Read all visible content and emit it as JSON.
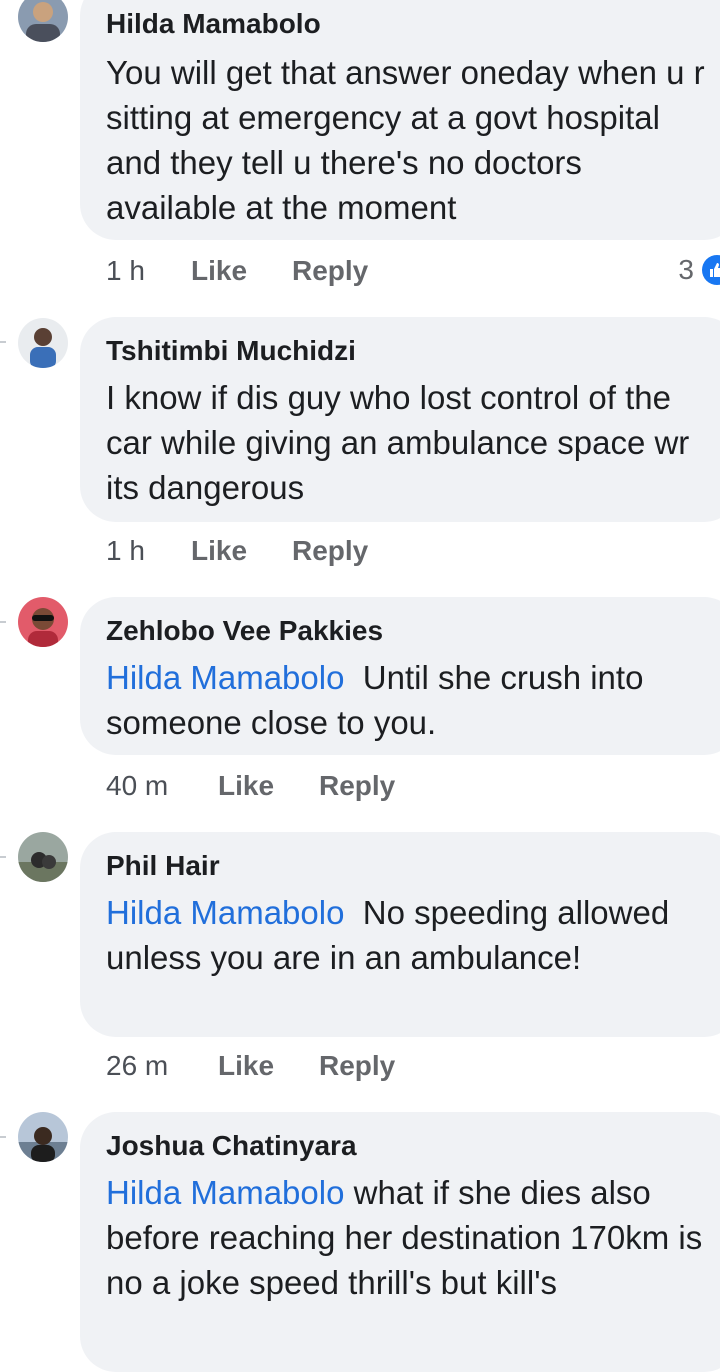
{
  "comments": [
    {
      "author": "Hilda Mamabolo",
      "mention": "",
      "text": "You will get that answer oneday when u r sitting at emergency at a govt hospital and they tell u there's no doctors available at the moment",
      "time": "1 h",
      "like": "Like",
      "reply": "Reply",
      "reactions": "3"
    },
    {
      "author": "Tshitimbi Muchidzi",
      "mention": "",
      "text": "I know if dis guy who lost control of the car while giving an ambulance space wr its dangerous",
      "time": "1 h",
      "like": "Like",
      "reply": "Reply"
    },
    {
      "author": "Zehlobo Vee Pakkies",
      "mention": "Hilda Mamabolo",
      "text": "Until she crush into someone close to you.",
      "time": "40 m",
      "like": "Like",
      "reply": "Reply"
    },
    {
      "author": "Phil Hair",
      "mention": "Hilda Mamabolo",
      "text": "No speeding allowed unless you are in an ambulance!",
      "time": "26 m",
      "like": "Like",
      "reply": "Reply"
    },
    {
      "author": "Joshua Chatinyara",
      "mention": "Hilda Mamabolo",
      "text": "what if she dies also before reaching her destination 170km is no a joke speed thrill's but kill's",
      "time": "",
      "like": "",
      "reply": ""
    }
  ],
  "icons": {
    "reaction": "like-icon",
    "avatar": "avatar"
  },
  "colors": {
    "mention": "#216fdb",
    "bubble": "#f0f2f5",
    "meta": "#65676b",
    "like_badge": "#1877f2"
  }
}
